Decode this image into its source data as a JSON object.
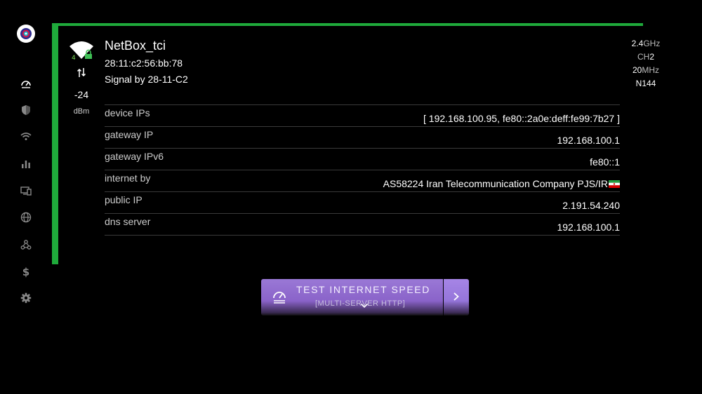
{
  "network": {
    "ssid": "NetBox_tci",
    "bssid": "28:11:c2:56:bb:78",
    "vendor": "Signal by 28-11-C2",
    "signal": "-24",
    "signal_unit": "dBm",
    "wifi_gen": "4",
    "band_value": "2.4",
    "band_unit": "GHz",
    "channel_label": "CH",
    "channel": "2",
    "width_value": "20",
    "width_unit": "MHz",
    "standard": "N144"
  },
  "details": {
    "rows": [
      {
        "key": "device IPs",
        "value": "[ 192.168.100.95, fe80::2a0e:deff:fe99:7b27 ]"
      },
      {
        "key": "gateway IP",
        "value": "192.168.100.1"
      },
      {
        "key": "gateway IPv6",
        "value": "fe80::1"
      },
      {
        "key": "internet by",
        "value": "AS58224 Iran Telecommunication Company PJS/IR"
      },
      {
        "key": "public IP",
        "value": "2.191.54.240"
      },
      {
        "key": "dns server",
        "value": "192.168.100.1"
      }
    ]
  },
  "speedtest": {
    "title": "TEST INTERNET SPEED",
    "subtitle": "[MULTI-SERVER HTTP]"
  },
  "icons": {
    "sidebar": [
      "speedometer-icon",
      "shield-icon",
      "wifi-icon",
      "bar-chart-icon",
      "devices-icon",
      "globe-icon",
      "webhook-icon",
      "dollar-icon",
      "gear-icon"
    ]
  },
  "colors": {
    "accent_green": "#1faa3b",
    "button_purple": "#8a63c9",
    "background": "#000000"
  }
}
